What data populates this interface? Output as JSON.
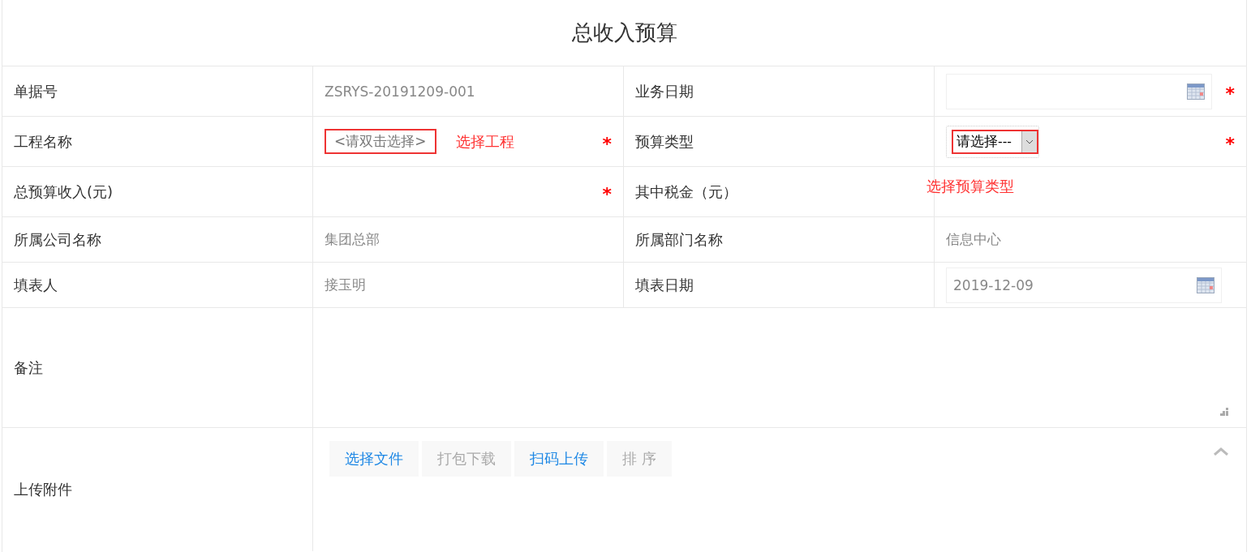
{
  "title": "总收入预算",
  "rows": [
    [
      {
        "label": "单据号",
        "kind": "text",
        "value": "ZSRYS-20191209-001"
      },
      {
        "label": "业务日期",
        "kind": "date",
        "required_mark": "*"
      }
    ],
    [
      {
        "label": "工程名称",
        "kind": "picker",
        "placeholder": "<请双击选择>",
        "highlighted": true,
        "note": "选择工程",
        "required_mark": "*"
      },
      {
        "label": "预算类型",
        "kind": "select",
        "value": "请选择---",
        "highlighted": true,
        "required_mark": "*"
      }
    ],
    [
      {
        "label": "总预算收入(元)",
        "kind": "input",
        "required_mark": "*"
      },
      {
        "label": "其中税金（元）",
        "kind": "note",
        "note": "选择预算类型"
      }
    ],
    [
      {
        "label": "所属公司名称",
        "kind": "text",
        "value": "集团总部"
      },
      {
        "label": "所属部门名称",
        "kind": "text",
        "value": "信息中心"
      }
    ],
    [
      {
        "label": "填表人",
        "kind": "text",
        "value": "接玉明"
      },
      {
        "label": "填表日期",
        "kind": "date",
        "value": "2019-12-09"
      }
    ]
  ],
  "remark": {
    "label": "备注"
  },
  "upload": {
    "label": "上传附件",
    "buttons": [
      {
        "label": "选择文件",
        "disabled": false
      },
      {
        "label": "打包下载",
        "disabled": true
      },
      {
        "label": "扫码上传",
        "disabled": false
      },
      {
        "label": "排 序",
        "disabled": true
      }
    ]
  }
}
